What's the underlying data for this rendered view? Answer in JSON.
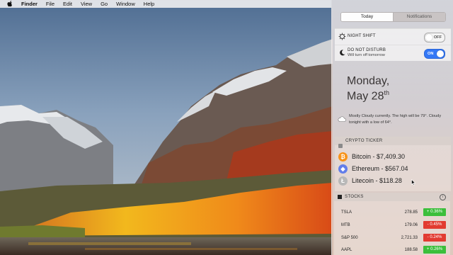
{
  "menubar": {
    "app": "Finder",
    "items": [
      "File",
      "Edit",
      "View",
      "Go",
      "Window",
      "Help"
    ]
  },
  "notification_center": {
    "tabs": [
      "Today",
      "Notifications"
    ],
    "selected_tab": "Today",
    "night_shift": {
      "label": "NIGHT SHIFT",
      "state": "OFF"
    },
    "do_not_disturb": {
      "label": "DO NOT DISTURB",
      "sub": "Will turn off tomorrow",
      "state": "ON"
    },
    "date_line1": "Monday,",
    "date_line2": "May 28",
    "date_suffix": "th",
    "weather_text": "Mostly Cloudy currently. The high will be 79°. Cloudy tonight with a low of 64°.",
    "crypto": {
      "title": "CRYPTO TICKER",
      "coins": [
        {
          "symbol_icon": "bitcoin-icon",
          "text": "Bitcoin - $7,409.30"
        },
        {
          "symbol_icon": "ethereum-icon",
          "text": "Ethereum - $567.04"
        },
        {
          "symbol_icon": "litecoin-icon",
          "text": "Litecoin - $118.28"
        }
      ]
    },
    "stocks": {
      "title": "STOCKS",
      "rows": [
        {
          "symbol": "TSLA",
          "price": "278.85",
          "change": "+ 0.36%",
          "dir": "up"
        },
        {
          "symbol": "MTB",
          "price": "179.06",
          "change": "- 0.45%",
          "dir": "down"
        },
        {
          "symbol": "S&P 500",
          "price": "2,721.33",
          "change": "- 0.24%",
          "dir": "down"
        },
        {
          "symbol": "AAPL",
          "price": "188.58",
          "change": "+ 0.26%",
          "dir": "up"
        }
      ]
    }
  },
  "colors": {
    "toggle_on": "#3478f6",
    "stock_up": "#3cbf3c",
    "stock_down": "#e23b31",
    "bitcoin": "#f7931a",
    "ethereum": "#627eea"
  }
}
